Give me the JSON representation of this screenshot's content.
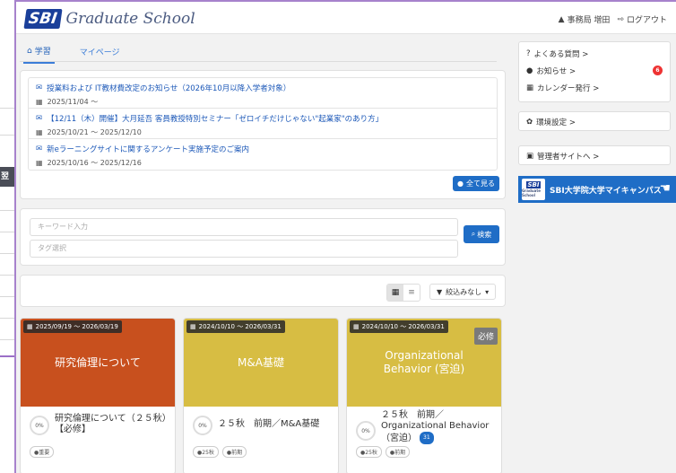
{
  "background_window": {
    "label": "翌日"
  },
  "header": {
    "logo_mark": "SBI",
    "logo_text": "Graduate School",
    "user": "事務局 増田",
    "logout": "ログアウト"
  },
  "tabs": [
    {
      "label": "学習",
      "active": true
    },
    {
      "label": "マイページ",
      "active": false
    }
  ],
  "notices": [
    {
      "title": "授業料および IT教材費改定のお知らせ（2026年10月以降入学者対象）",
      "date": "2025/11/04 ～"
    },
    {
      "title": "【12/11（木）開催】大月延吾 客員教授特別セミナー「ゼロイチだけじゃない\"起業家\"のあり方」",
      "date": "2025/10/21 ～ 2025/12/10"
    },
    {
      "title": "新eラーニングサイトに関するアンケート実施予定のご案内",
      "date": "2025/10/16 ～ 2025/12/16"
    }
  ],
  "see_all_label": "全て見る",
  "search": {
    "keyword_placeholder": "キーワード入力",
    "tag_placeholder": "タグ選択",
    "button_label": "検索"
  },
  "toolbar": {
    "filter_label": "絞込みなし"
  },
  "courses": [
    {
      "date": "2025/09/19 ～ 2026/03/19",
      "image_text": "研究倫理について",
      "required": "",
      "progress": "0%",
      "title": "研究倫理について（２５秋）【必修】",
      "count": "",
      "tags": [
        "重要"
      ],
      "color": "#c8501e"
    },
    {
      "date": "2024/10/10 ～ 2026/03/31",
      "image_text": "M&A基礎",
      "required": "",
      "progress": "0%",
      "title": "２５秋　前期／M&A基礎",
      "count": "",
      "tags": [
        "25秋",
        "前期"
      ],
      "color": "#d7bd43"
    },
    {
      "date": "2024/10/10 ～ 2026/03/31",
      "image_text": "Organizational Behavior (宮迫)",
      "required": "必修",
      "progress": "0%",
      "title": "２５秋　前期／Organizational Behavior（宮迫）",
      "count": "31",
      "tags": [
        "25秋",
        "前期"
      ],
      "color": "#d7bd43"
    }
  ],
  "sidebar": {
    "group1": [
      {
        "icon": "?",
        "label": "よくある質問 >",
        "badge": ""
      },
      {
        "icon": "●",
        "label": "お知らせ >",
        "badge": "6"
      },
      {
        "icon": "▦",
        "label": "カレンダー発行 >",
        "badge": ""
      }
    ],
    "settings_label": "環境設定 >",
    "admin_label": "管理者サイトへ >",
    "campus": {
      "logo_mark": "SBI",
      "logo_sub": "Graduate School",
      "label": "SBI大学院大学マイキャンパス"
    }
  },
  "colors": {
    "accent": "#1f6dc6",
    "alert": "#e33333",
    "course_red": "#c8501e",
    "course_yellow": "#d7bd43"
  }
}
